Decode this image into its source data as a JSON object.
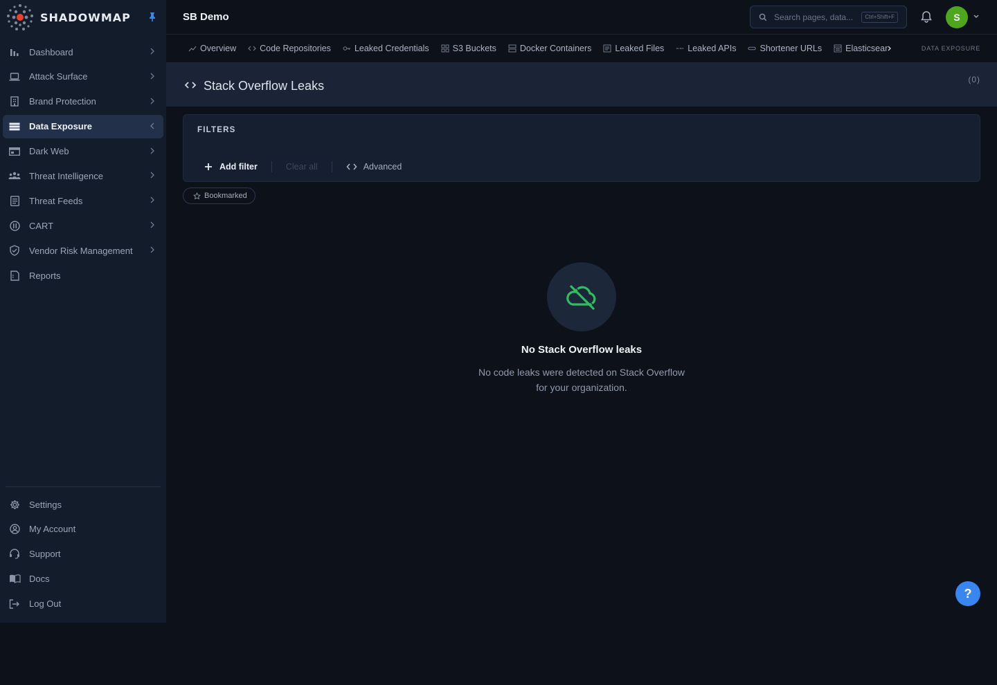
{
  "brand": {
    "name": "SHADOWMAP"
  },
  "colors": {
    "accent_green": "#2fbf5f",
    "avatar_bg": "#4ea51e",
    "help_blue": "#3a86f0",
    "active_nav_bg": "#223049"
  },
  "sidebar": {
    "items": [
      {
        "label": "Dashboard",
        "icon": "bar-chart-icon"
      },
      {
        "label": "Attack Surface",
        "icon": "laptop-icon"
      },
      {
        "label": "Brand Protection",
        "icon": "building-icon"
      },
      {
        "label": "Data Exposure",
        "icon": "database-icon",
        "active": true
      },
      {
        "label": "Dark Web",
        "icon": "browser-icon"
      },
      {
        "label": "Threat Intelligence",
        "icon": "users-icon"
      },
      {
        "label": "Threat Feeds",
        "icon": "document-icon"
      },
      {
        "label": "CART",
        "icon": "alert-circle-icon"
      },
      {
        "label": "Vendor Risk Management",
        "icon": "shield-check-icon"
      },
      {
        "label": "Reports",
        "icon": "report-icon"
      }
    ],
    "bottom_items": [
      {
        "label": "Settings",
        "icon": "gear-icon"
      },
      {
        "label": "My Account",
        "icon": "user-circle-icon"
      },
      {
        "label": "Support",
        "icon": "headset-icon"
      },
      {
        "label": "Docs",
        "icon": "book-icon"
      },
      {
        "label": "Log Out",
        "icon": "logout-icon"
      }
    ]
  },
  "topbar": {
    "org_name": "SB Demo",
    "search_placeholder": "Search pages, data...",
    "search_shortcut": "Ctrl+Shift+F",
    "avatar_initial": "S"
  },
  "tabs": {
    "items": [
      {
        "label": "Overview",
        "icon": "trend-icon"
      },
      {
        "label": "Code Repositories",
        "icon": "code-icon"
      },
      {
        "label": "Leaked Credentials",
        "icon": "key-icon"
      },
      {
        "label": "S3 Buckets",
        "icon": "grid-icon"
      },
      {
        "label": "Docker Containers",
        "icon": "server-icon"
      },
      {
        "label": "Leaked Files",
        "icon": "file-icon"
      },
      {
        "label": "Leaked APIs",
        "icon": "api-icon"
      },
      {
        "label": "Shortener URLs",
        "icon": "link-icon"
      },
      {
        "label": "Elasticsear",
        "icon": "table-icon"
      }
    ],
    "section_label": "DATA EXPOSURE"
  },
  "page": {
    "title": "Stack Overflow Leaks",
    "count": "(0)"
  },
  "filters": {
    "title": "FILTERS",
    "add_filter": "Add filter",
    "clear_all": "Clear all",
    "advanced": "Advanced",
    "bookmarked": "Bookmarked"
  },
  "empty_state": {
    "title": "No Stack Overflow leaks",
    "line1": "No code leaks were detected on Stack Overflow",
    "line2": "for your organization."
  },
  "help": {
    "label": "?"
  }
}
